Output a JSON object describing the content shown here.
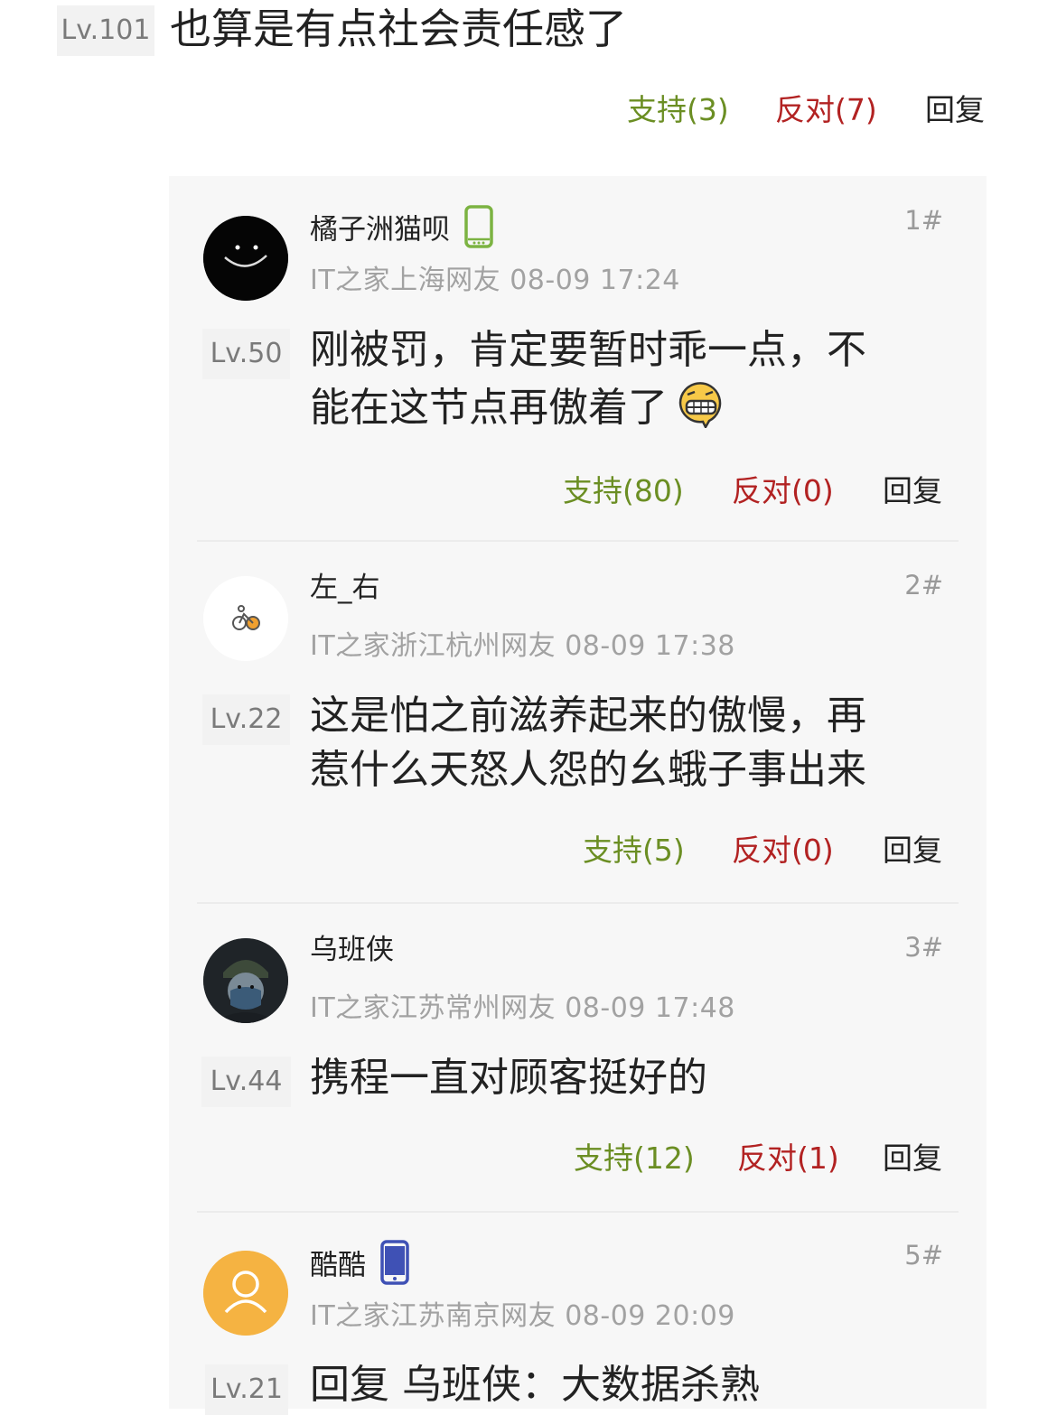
{
  "parent": {
    "level": "Lv.101",
    "text": "也算是有点社会责任感了",
    "support": "支持(3)",
    "oppose": "反对(7)",
    "reply": "回复"
  },
  "colors": {
    "support": "#6b8e23",
    "oppose": "#b22222",
    "panel_bg": "#f7f7f7"
  },
  "comments": [
    {
      "username": "橘子洲猫呗",
      "floor": "1#",
      "meta": "IT之家上海网友 08-09 17:24",
      "level": "Lv.50",
      "text_line1": "刚被罚，肯定要暂时乖一点，不",
      "text_line2": "能在这节点再傲着了",
      "support": "支持(80)",
      "oppose": "反对(0)",
      "reply": "回复",
      "device": "android-phone-icon",
      "emoji": "grin-emoji-icon"
    },
    {
      "username": "左_右",
      "floor": "2#",
      "meta": "IT之家浙江杭州网友 08-09 17:38",
      "level": "Lv.22",
      "text_line1": "这是怕之前滋养起来的傲慢，再",
      "text_line2": "惹什么天怒人怨的幺蛾子事出来",
      "support": "支持(5)",
      "oppose": "反对(0)",
      "reply": "回复"
    },
    {
      "username": "乌班侠",
      "floor": "3#",
      "meta": "IT之家江苏常州网友 08-09 17:48",
      "level": "Lv.44",
      "text_line1": "携程一直对顾客挺好的",
      "support": "支持(12)",
      "oppose": "反对(1)",
      "reply": "回复"
    },
    {
      "username": "酷酷",
      "floor": "5#",
      "meta": "IT之家江苏南京网友 08-09 20:09",
      "level": "Lv.21",
      "text_line1": "回复 乌班侠：大数据杀熟",
      "device": "iphone-icon"
    }
  ]
}
